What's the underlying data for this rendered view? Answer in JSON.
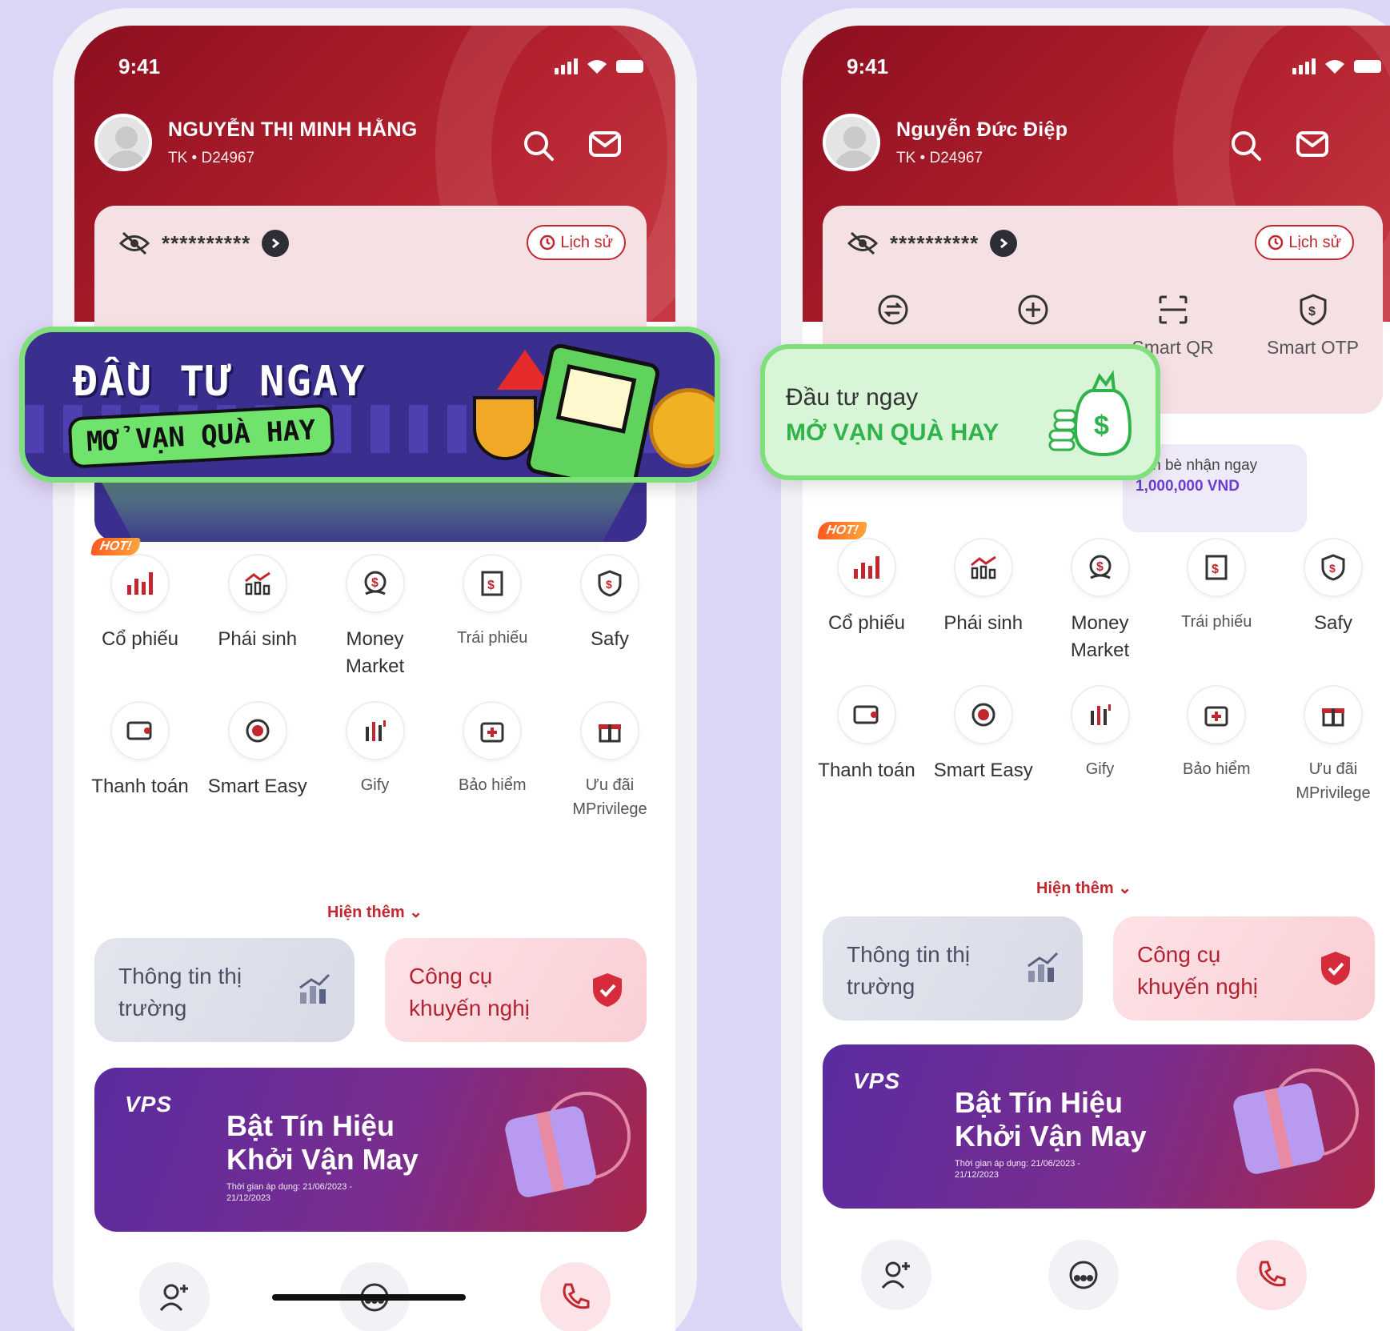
{
  "phones": [
    {
      "status_time": "9:41",
      "user_name": "NGUYỄN THỊ MINH HẰNG",
      "account": "TK • D24967",
      "balance_masked": "**********",
      "history_label": "Lịch sử",
      "grid_row1": [
        {
          "label": "Cổ phiếu",
          "hot": "HOT!"
        },
        {
          "label": "Phái sinh"
        },
        {
          "label": "Money Market"
        },
        {
          "label": "Trái phiếu"
        },
        {
          "label": "Safy"
        }
      ],
      "grid_row2": [
        {
          "label": "Thanh toán"
        },
        {
          "label": "Smart Easy"
        },
        {
          "label": "Gify"
        },
        {
          "label": "Bảo hiểm"
        },
        {
          "label": "Ưu đãi MPrivilege"
        }
      ],
      "show_more": "Hiện thêm ⌄",
      "tool_market": "Thông tin thị trường",
      "tool_recommend": "Công cụ khuyến nghị",
      "banner_logo": "VPS",
      "banner_title": "Bật Tín Hiệu Khởi Vận May",
      "banner_period": "Thời gian áp dụng: 21/06/2023 - 21/12/2023"
    },
    {
      "status_time": "9:41",
      "user_name": "Nguyễn Đức Điệp",
      "account": "TK • D24967",
      "balance_masked": "**********",
      "history_label": "Lịch sử",
      "quick_actions": [
        {
          "label": ""
        },
        {
          "label": ""
        },
        {
          "label": "Smart QR"
        },
        {
          "label": "Smart OTP"
        }
      ],
      "grid_row1": [
        {
          "label": "Cổ phiếu",
          "hot": "HOT!"
        },
        {
          "label": "Phái sinh"
        },
        {
          "label": "Money Market"
        },
        {
          "label": "Trái phiếu"
        },
        {
          "label": "Safy"
        }
      ],
      "grid_row2": [
        {
          "label": "Thanh toán"
        },
        {
          "label": "Smart Easy"
        },
        {
          "label": "Gify"
        },
        {
          "label": "Bảo hiểm"
        },
        {
          "label": "Ưu đãi MPrivilege"
        }
      ],
      "show_more": "Hiện thêm ⌄",
      "tool_market": "Thông tin thị trường",
      "tool_recommend": "Công cụ khuyến nghị",
      "friend_text": "bạn bè nhận ngay",
      "friend_amount": "1,000,000 VND",
      "banner_logo": "VPS",
      "banner_title": "Bật Tín Hiệu Khởi Vận May",
      "banner_period": "Thời gian áp dụng: 21/06/2023 - 21/12/2023"
    }
  ],
  "callout_pixel": {
    "line1": "ĐẦU TƯ NGAY",
    "line2": "MỞ VẠN QUÀ HAY"
  },
  "callout_flat": {
    "line1": "Đầu tư ngay",
    "line2": "MỞ VẠN QUÀ HAY"
  },
  "colors": {
    "brand_red": "#b3212e",
    "accent_green": "#7de07a",
    "background": "#ddd5f6"
  }
}
